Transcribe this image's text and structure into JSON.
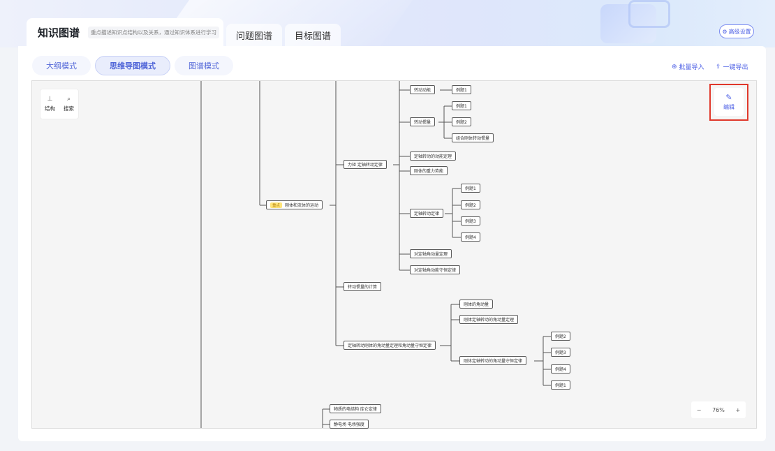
{
  "header": {
    "tab_active": "知识图谱",
    "tab_active_desc": "重点描述知识点结构以及关系，通过知识体系进行学习",
    "tab2": "问题图谱",
    "tab3": "目标图谱",
    "advanced_settings": "高级设置"
  },
  "modes": {
    "outline": "大纲模式",
    "mindmap": "思维导图模式",
    "graph": "图谱模式"
  },
  "actions": {
    "batch_import": "批量导入",
    "export": "一键导出"
  },
  "side_tools": {
    "structure": "结构",
    "search": "搜索"
  },
  "edit": {
    "label": "编辑"
  },
  "zoom": {
    "minus": "−",
    "level": "76%",
    "plus": "+"
  },
  "nodes": {
    "rigid_fluid": "刚体和流体的运动",
    "key_badge": "重点",
    "torque": "力矩 定轴转动定律",
    "rot_ke": "转动动能",
    "ex1_a": "例题1",
    "rot_inertia": "转动惯量",
    "ex1_b": "例题1",
    "ex2_b": "例题2",
    "combined_inertia": "组合刚体转动惯量",
    "ke_theorem": "定轴转动的动能定理",
    "grav_pe": "刚体的重力势能",
    "rot_law": "定轴转动定律",
    "ex1_c": "例题1",
    "ex2_c": "例题2",
    "ex3_c": "例题3",
    "ex4_c": "例题4",
    "am_theorem": "对定轴角动量定理",
    "am_conservation": "对定轴角动能守恒定律",
    "inertia_calc": "转动惯量的计算",
    "am_group": "定轴转动刚体的角动量定理和角动量守恒定律",
    "rigid_am": "刚体的角动量",
    "rigid_am_theorem": "刚体定轴转动的角动量定理",
    "rigid_am_conservation": "刚体定轴转动的角动量守恒定律",
    "ex2_d": "例题2",
    "ex3_d": "例题3",
    "ex4_d": "例题4",
    "ex1_d": "例题1",
    "coulomb": "物质的电结构 库仑定律",
    "electrostatic": "静电场 电场强度"
  }
}
